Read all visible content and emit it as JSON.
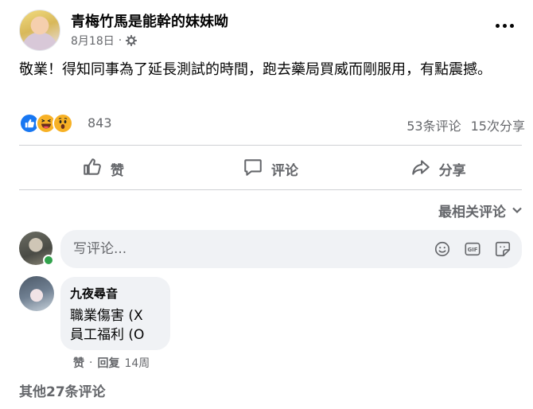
{
  "post": {
    "author": "青梅竹馬是能幹的妹妹呦",
    "date": "8月18日",
    "separator": "·",
    "text": "敬業！得知同事為了延長測試的時間，跑去藥局買威而剛服用，有點震撼。",
    "reaction_count": "843",
    "comment_count": "53条评论",
    "share_count": "15次分享"
  },
  "actions": {
    "like": "赞",
    "comment": "评论",
    "share": "分享"
  },
  "sort": {
    "label": "最相关评论"
  },
  "composer": {
    "placeholder": "写评论..."
  },
  "comment": {
    "author": "九夜尋音",
    "line1": "職業傷害 (X",
    "line2": "員工福利 (O",
    "like": "赞",
    "dot": "·",
    "reply": "回复",
    "age": "14周"
  },
  "more_comments": "其他27条评论",
  "colors": {
    "like_blue": "#1877f2",
    "reaction_yellow": "#f7b125",
    "secondary_text": "#65676b",
    "bubble_bg": "#f0f2f5",
    "online_green": "#31a24c"
  }
}
